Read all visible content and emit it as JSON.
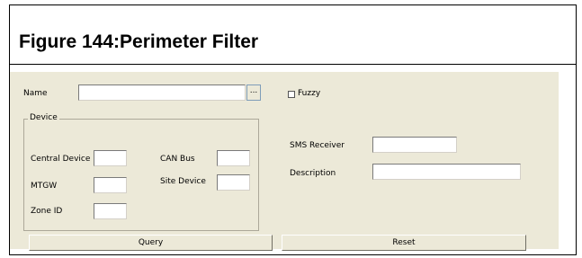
{
  "figure": {
    "title": "Figure 144:Perimeter Filter"
  },
  "form": {
    "name_label": "Name",
    "name_value": "",
    "browse_label": "...",
    "fuzzy_label": "Fuzzy",
    "fuzzy_checked": false,
    "device_group_label": "Device",
    "central_device_label": "Central Device",
    "central_device_value": "",
    "can_bus_label": "CAN Bus",
    "can_bus_value": "",
    "mtgw_label": "MTGW",
    "mtgw_value": "",
    "site_device_label": "Site Device",
    "site_device_value": "",
    "zone_id_label": "Zone ID",
    "zone_id_value": "",
    "sms_receiver_label": "SMS Receiver",
    "sms_receiver_value": "",
    "description_label": "Description",
    "description_value": ""
  },
  "buttons": {
    "query_label": "Query",
    "reset_label": "Reset"
  },
  "colors": {
    "panel_bg": "#ece9d8",
    "frame_border": "#000000"
  }
}
